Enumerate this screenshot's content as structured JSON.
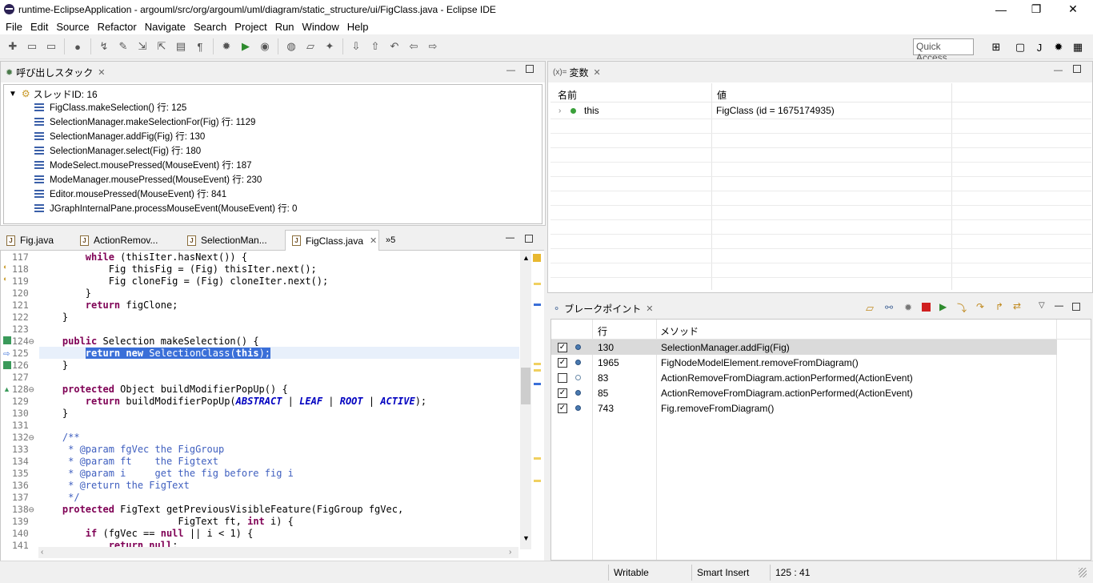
{
  "window": {
    "title": "runtime-EclipseApplication - argouml/src/org/argouml/uml/diagram/static_structure/ui/FigClass.java - Eclipse IDE",
    "minimize": "—",
    "maximize": "❐",
    "close": "✕"
  },
  "menu": [
    "File",
    "Edit",
    "Source",
    "Refactor",
    "Navigate",
    "Search",
    "Project",
    "Run",
    "Window",
    "Help"
  ],
  "toolbar": {
    "quick_access": "Quick Access"
  },
  "debug_view": {
    "title": "呼び出しスタック",
    "thread": "スレッドID: 16",
    "frames": [
      "FigClass.makeSelection() 行: 125",
      "SelectionManager.makeSelectionFor(Fig) 行: 1129",
      "SelectionManager.addFig(Fig) 行: 130",
      "SelectionManager.select(Fig) 行: 180",
      "ModeSelect.mousePressed(MouseEvent) 行: 187",
      "ModeManager.mousePressed(MouseEvent) 行: 230",
      "Editor.mousePressed(MouseEvent) 行: 841",
      "JGraphInternalPane.processMouseEvent(MouseEvent) 行: 0"
    ]
  },
  "variables_view": {
    "title_prefix": "(x)=",
    "title": "変数",
    "col_name": "名前",
    "col_value": "値",
    "rows": [
      {
        "name": "this",
        "value": "FigClass (id = 1675174935)"
      }
    ]
  },
  "editor": {
    "tabs": [
      "Fig.java",
      "ActionRemov...",
      "SelectionMan...",
      "FigClass.java"
    ],
    "overflow": "»5",
    "active_tab": 3,
    "lines": [
      {
        "n": "117",
        "html": "        <span class=\"kw\">while</span> (thisIter.hasNext()) {"
      },
      {
        "n": "118",
        "html": "            Fig thisFig = (Fig) thisIter.next();"
      },
      {
        "n": "119",
        "html": "            Fig cloneFig = (Fig) cloneIter.next();"
      },
      {
        "n": "120",
        "html": "        }"
      },
      {
        "n": "121",
        "html": "        <span class=\"kw\">return</span> figClone;"
      },
      {
        "n": "122",
        "html": "    }"
      },
      {
        "n": "123",
        "html": ""
      },
      {
        "n": "124⊖",
        "html": "    <span class=\"kw\">public</span> Selection makeSelection() {"
      },
      {
        "n": "125",
        "html": "        <span class=\"hl\"><span class=\"kw\">return</span> <span class=\"kw\">new</span> SelectionClass(<span class=\"kw\">this</span>);</span>"
      },
      {
        "n": "126",
        "html": "    }"
      },
      {
        "n": "127",
        "html": ""
      },
      {
        "n": "128⊖",
        "html": "    <span class=\"kw\">protected</span> Object buildModifierPopUp() {"
      },
      {
        "n": "129",
        "html": "        <span class=\"kw\">return</span> buildModifierPopUp(<span class=\"cst\">ABSTRACT</span> | <span class=\"cst\">LEAF</span> | <span class=\"cst\">ROOT</span> | <span class=\"cst\">ACTIVE</span>);"
      },
      {
        "n": "130",
        "html": "    }"
      },
      {
        "n": "131",
        "html": ""
      },
      {
        "n": "132⊖",
        "html": "    <span class=\"cm\">/**</span>"
      },
      {
        "n": "133",
        "html": "<span class=\"cm\">     * @param fgVec the FigGroup</span>"
      },
      {
        "n": "134",
        "html": "<span class=\"cm\">     * @param ft    the Figtext</span>"
      },
      {
        "n": "135",
        "html": "<span class=\"cm\">     * @param i     get the fig before fig i</span>"
      },
      {
        "n": "136",
        "html": "<span class=\"cm\">     * @return the FigText</span>"
      },
      {
        "n": "137",
        "html": "<span class=\"cm\">     */</span>"
      },
      {
        "n": "138⊖",
        "html": "    <span class=\"kw\">protected</span> FigText getPreviousVisibleFeature(FigGroup fgVec,"
      },
      {
        "n": "139",
        "html": "                        FigText ft, <span class=\"kw\">int</span> i) {"
      },
      {
        "n": "140",
        "html": "        <span class=\"kw\">if</span> (fgVec == <span class=\"kw\">null</span> || i &lt; 1) {"
      },
      {
        "n": "141",
        "html": "            <span class=\"kw\">return</span> <span class=\"kw\">null</span>;"
      }
    ]
  },
  "breakpoints_view": {
    "title": "ブレークポイント",
    "col_line": "行",
    "col_method": "メソッド",
    "rows": [
      {
        "checked": true,
        "enabled": true,
        "line": "130",
        "method": "SelectionManager.addFig(Fig)"
      },
      {
        "checked": true,
        "enabled": true,
        "line": "1965",
        "method": "FigNodeModelElement.removeFromDiagram()"
      },
      {
        "checked": false,
        "enabled": false,
        "line": "83",
        "method": "ActionRemoveFromDiagram.actionPerformed(ActionEvent)"
      },
      {
        "checked": true,
        "enabled": true,
        "line": "85",
        "method": "ActionRemoveFromDiagram.actionPerformed(ActionEvent)"
      },
      {
        "checked": true,
        "enabled": true,
        "line": "743",
        "method": "Fig.removeFromDiagram()"
      }
    ]
  },
  "statusbar": {
    "writable": "Writable",
    "insert_mode": "Smart Insert",
    "position": "125 : 41"
  }
}
